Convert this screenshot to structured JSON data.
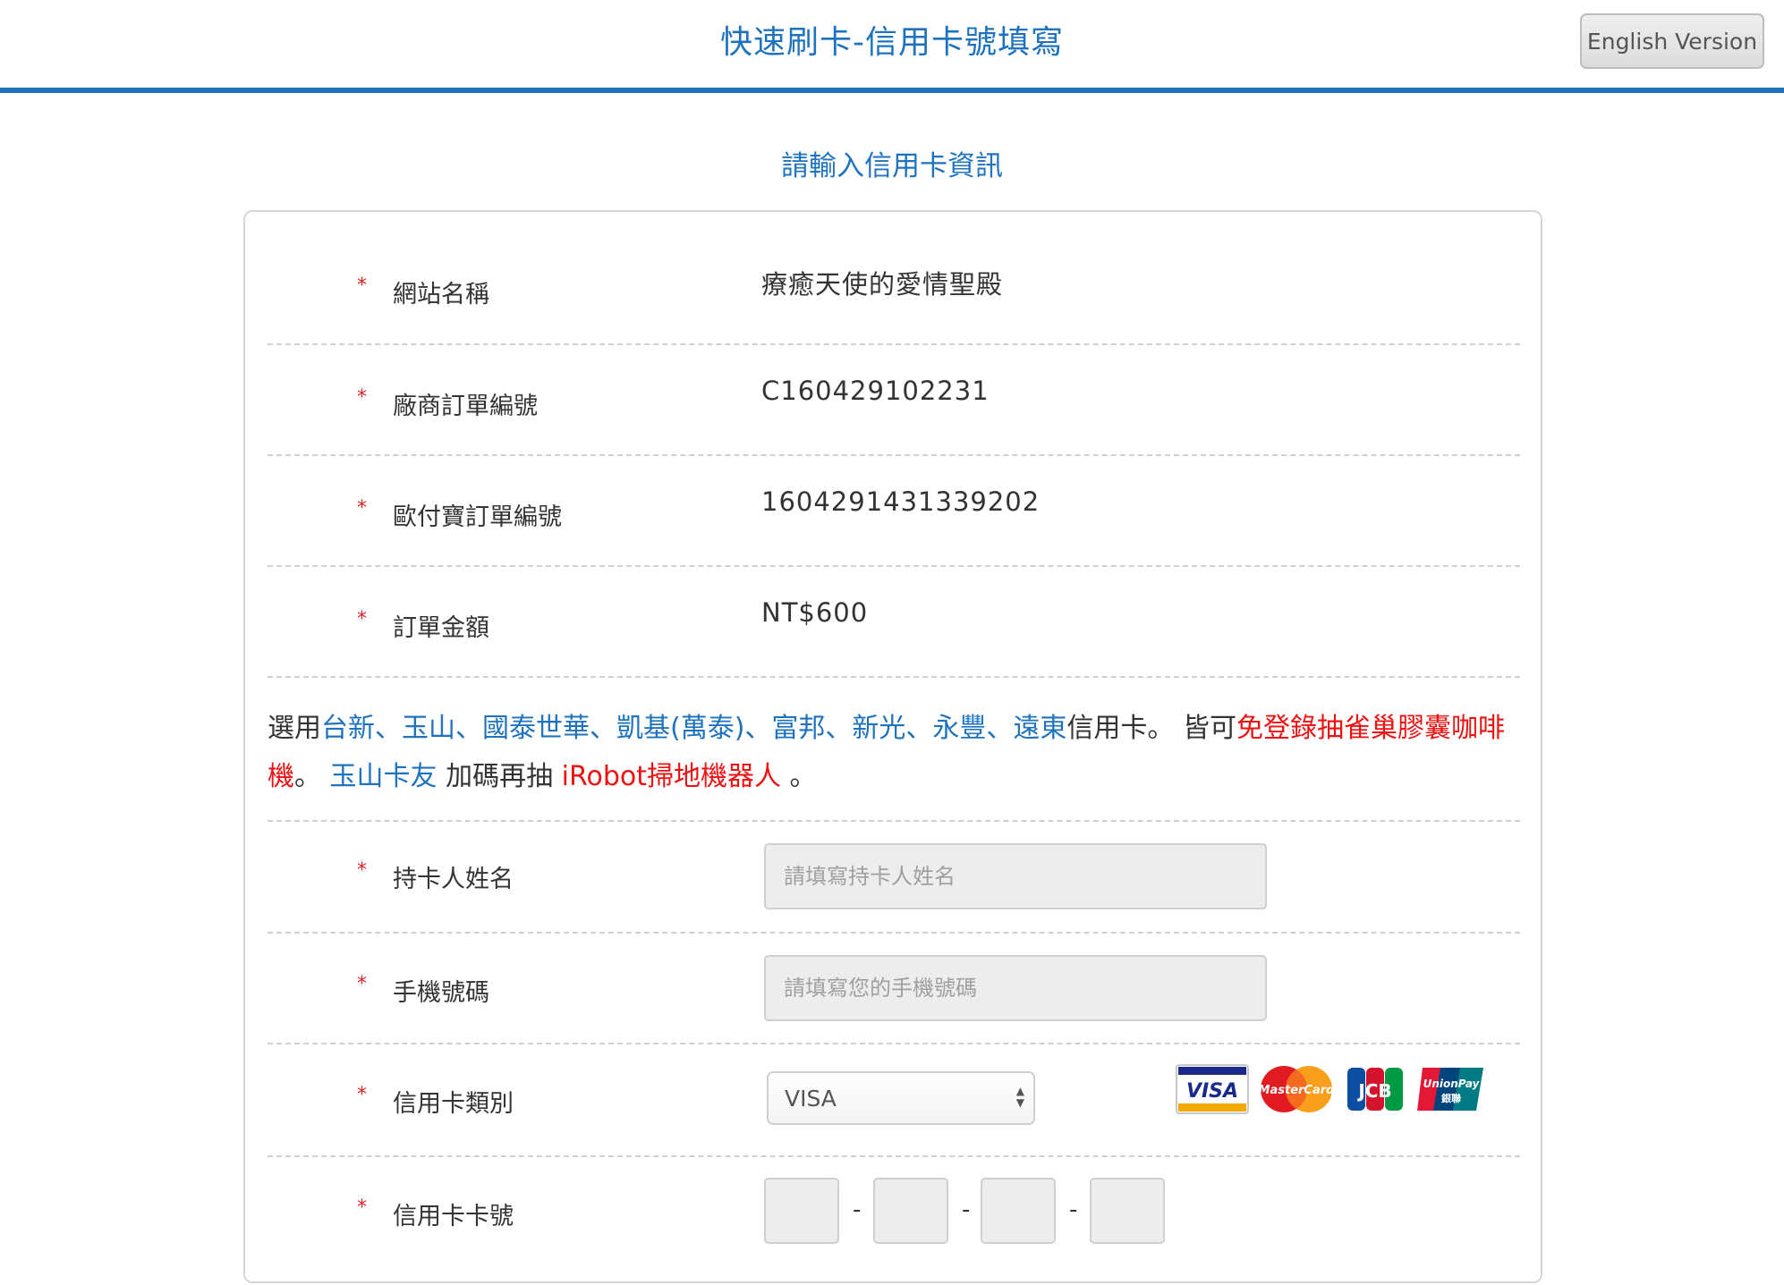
{
  "header": {
    "title": "快速刷卡-信用卡號填寫",
    "english_button": "English Version"
  },
  "sub_title": "請輸入信用卡資訊",
  "required_mark": "*",
  "order_info": [
    {
      "label": "網站名稱",
      "value": "療癒天使的愛情聖殿"
    },
    {
      "label": "廠商訂單編號",
      "value": "C160429102231"
    },
    {
      "label": "歐付寶訂單編號",
      "value": "1604291431339202"
    },
    {
      "label": "訂單金額",
      "value": "NT$600"
    }
  ],
  "promo": {
    "prefix": "選用",
    "banks": "台新、玉山、國泰世華、凱基(萬泰)、富邦、新光、永豐、遠東",
    "suffix": "信用卡。 皆可",
    "prize1": "免登錄抽雀巢膠囊咖啡機",
    "sep": "。",
    "esun": "玉山卡友",
    "plus": "加碼再抽",
    "prize2": "iRobot掃地機器人",
    "end": "。"
  },
  "form": {
    "holder_label": "持卡人姓名",
    "holder_placeholder": "請填寫持卡人姓名",
    "phone_label": "手機號碼",
    "phone_placeholder": "請填寫您的手機號碼",
    "card_type_label": "信用卡類別",
    "card_type_selected": "VISA",
    "card_number_label": "信用卡卡號",
    "card_number_separator": "-"
  },
  "card_logos": [
    "VISA",
    "MasterCard",
    "JCB",
    "UnionPay"
  ],
  "card_logo_texts": {
    "visa": "VISA",
    "mastercard": "MasterCard",
    "jcb": "JCB",
    "unionpay": "UnionPay",
    "unionpay_cn": "銀聯"
  },
  "colors": {
    "primary_blue": "#1f73be",
    "promo_red": "#ee1111",
    "required_red": "#e02020"
  }
}
